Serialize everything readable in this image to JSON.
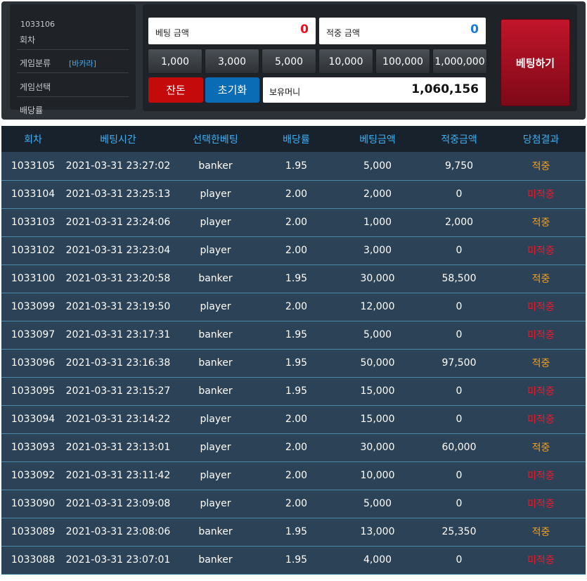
{
  "info": {
    "round_no": "1033106",
    "round_label": "회차",
    "category_label": "게임분류",
    "category_value": "[바카라]",
    "select_label": "게임선택",
    "odds_label": "배당률"
  },
  "bet": {
    "bet_amount_label": "베팅 금액",
    "bet_amount_value": "0",
    "win_amount_label": "적중 금액",
    "win_amount_value": "0",
    "chips": [
      "1,000",
      "3,000",
      "5,000",
      "10,000",
      "100,000",
      "1,000,000"
    ],
    "balance_button": "잔돈",
    "reset_button": "초기화",
    "balance_label": "보유머니",
    "balance_value": "1,060,156",
    "place_button": "베팅하기"
  },
  "table": {
    "headers": [
      "회차",
      "베팅시간",
      "선택한베팅",
      "배당률",
      "베팅금액",
      "적중금액",
      "당첨결과"
    ],
    "rows": [
      [
        "1033105",
        "2021-03-31 23:27:02",
        "banker",
        "1.95",
        "5,000",
        "9,750",
        "적중"
      ],
      [
        "1033104",
        "2021-03-31 23:25:13",
        "player",
        "2.00",
        "2,000",
        "0",
        "미적중"
      ],
      [
        "1033103",
        "2021-03-31 23:24:06",
        "player",
        "2.00",
        "1,000",
        "2,000",
        "적중"
      ],
      [
        "1033102",
        "2021-03-31 23:23:04",
        "player",
        "2.00",
        "3,000",
        "0",
        "미적중"
      ],
      [
        "1033100",
        "2021-03-31 23:20:58",
        "banker",
        "1.95",
        "30,000",
        "58,500",
        "적중"
      ],
      [
        "1033099",
        "2021-03-31 23:19:50",
        "player",
        "2.00",
        "12,000",
        "0",
        "미적중"
      ],
      [
        "1033097",
        "2021-03-31 23:17:31",
        "banker",
        "1.95",
        "5,000",
        "0",
        "미적중"
      ],
      [
        "1033096",
        "2021-03-31 23:16:38",
        "banker",
        "1.95",
        "50,000",
        "97,500",
        "적중"
      ],
      [
        "1033095",
        "2021-03-31 23:15:27",
        "banker",
        "1.95",
        "15,000",
        "0",
        "미적중"
      ],
      [
        "1033094",
        "2021-03-31 23:14:22",
        "player",
        "2.00",
        "15,000",
        "0",
        "미적중"
      ],
      [
        "1033093",
        "2021-03-31 23:13:01",
        "player",
        "2.00",
        "30,000",
        "60,000",
        "적중"
      ],
      [
        "1033092",
        "2021-03-31 23:11:42",
        "player",
        "2.00",
        "10,000",
        "0",
        "미적중"
      ],
      [
        "1033090",
        "2021-03-31 23:09:08",
        "player",
        "2.00",
        "5,000",
        "0",
        "미적중"
      ],
      [
        "1033089",
        "2021-03-31 23:08:06",
        "banker",
        "1.95",
        "13,000",
        "25,350",
        "적중"
      ],
      [
        "1033088",
        "2021-03-31 23:07:01",
        "banker",
        "1.95",
        "4,000",
        "0",
        "미적중"
      ]
    ]
  },
  "colors": {
    "win": "#f0a020",
    "lose": "#f01828",
    "header_text": "#3fb0f5",
    "bet_amount": "#e8101e",
    "win_amount": "#1a78d8",
    "balance_button_bg": "#c40a0a",
    "reset_button_bg": "#0a6cb4",
    "place_button_bg": "#a01022"
  }
}
